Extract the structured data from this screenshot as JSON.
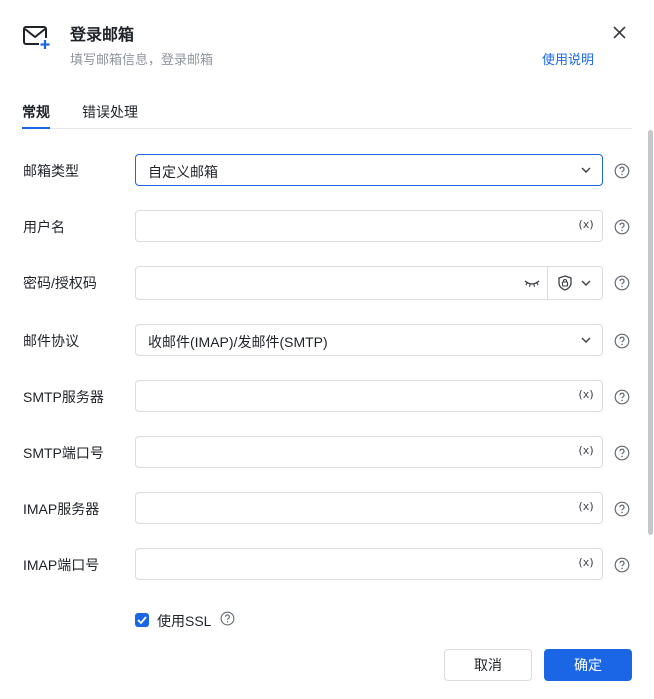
{
  "header": {
    "title": "登录邮箱",
    "subtitle": "填写邮箱信息，登录邮箱",
    "help_link": "使用说明",
    "icon": "mail-plus-icon"
  },
  "tabs": [
    {
      "label": "常规",
      "active": true
    },
    {
      "label": "错误处理",
      "active": false
    }
  ],
  "fields": {
    "mailbox_type": {
      "label": "邮箱类型",
      "value": "自定义邮箱"
    },
    "username": {
      "label": "用户名",
      "value": "",
      "var_icon": "(x)"
    },
    "password": {
      "label": "密码/授权码",
      "value": ""
    },
    "protocol": {
      "label": "邮件协议",
      "value": "收邮件(IMAP)/发邮件(SMTP)"
    },
    "smtp_server": {
      "label": "SMTP服务器",
      "value": "",
      "var_icon": "(x)"
    },
    "smtp_port": {
      "label": "SMTP端口号",
      "value": "",
      "var_icon": "(x)"
    },
    "imap_server": {
      "label": "IMAP服务器",
      "value": "",
      "var_icon": "(x)"
    },
    "imap_port": {
      "label": "IMAP端口号",
      "value": "",
      "var_icon": "(x)"
    }
  },
  "ssl": {
    "label": "使用SSL",
    "checked": true
  },
  "footer": {
    "cancel_label": "取消",
    "ok_label": "确定"
  },
  "colors": {
    "accent": "#1a66e5",
    "border": "#d9dce1",
    "muted": "#8f959e"
  }
}
